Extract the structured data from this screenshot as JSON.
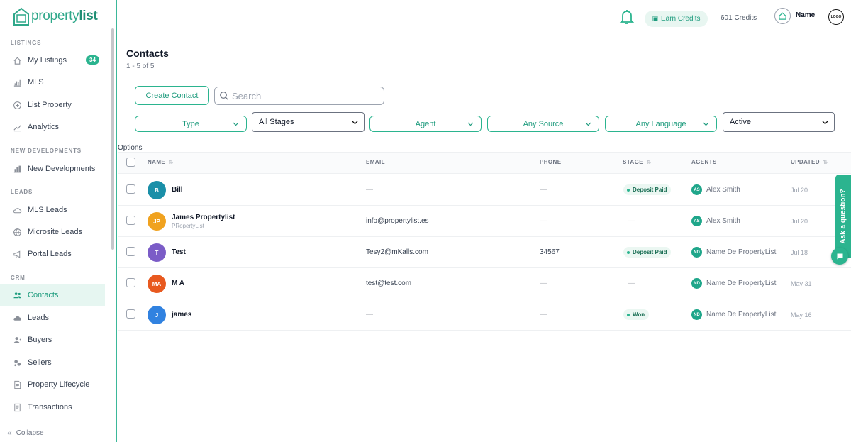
{
  "app": {
    "logo_text_1": "property",
    "logo_text_2": "list"
  },
  "sidebar": {
    "sections": {
      "listings": "LISTINGS",
      "new_developments": "NEW DEVELOPMENTS",
      "leads": "LEADS",
      "crm": "CRM"
    },
    "items": [
      {
        "label": "My Listings",
        "badge": "34",
        "icon": "home-icon"
      },
      {
        "label": "MLS",
        "icon": "chart-icon"
      },
      {
        "label": "List Property",
        "icon": "plus-circle-icon"
      },
      {
        "label": "Analytics",
        "icon": "trend-icon"
      },
      {
        "label": "New Developments",
        "icon": "building-icon"
      },
      {
        "label": "MLS Leads",
        "icon": "cloud-icon"
      },
      {
        "label": "Microsite Leads",
        "icon": "globe-icon"
      },
      {
        "label": "Portal Leads",
        "icon": "megaphone-icon"
      },
      {
        "label": "Contacts",
        "icon": "users-icon"
      },
      {
        "label": "Leads",
        "icon": "cloud-icon"
      },
      {
        "label": "Buyers",
        "icon": "user-icon"
      },
      {
        "label": "Sellers",
        "icon": "gear-cluster-icon"
      },
      {
        "label": "Property Lifecycle",
        "icon": "document-icon"
      },
      {
        "label": "Transactions",
        "icon": "receipt-icon"
      }
    ],
    "collapse_label": "Collapse"
  },
  "header": {
    "earn_credits": "Earn Credits",
    "credits": "601 Credits",
    "user_name": "Name",
    "brand_badge": "LOGO"
  },
  "main": {
    "title": "Contacts",
    "count": "1 - 5 of 5",
    "create_button": "Create Contact",
    "search_placeholder": "Search",
    "filters": {
      "type": "Type",
      "stages": "All Stages",
      "agent": "Agent",
      "source": "Any Source",
      "language": "Any Language",
      "status": "Active"
    },
    "options_label": "Options",
    "columns": {
      "name": "NAME",
      "email": "EMAIL",
      "phone": "PHONE",
      "stage": "STAGE",
      "agents": "AGENTS",
      "updated": "UPDATED"
    },
    "rows": [
      {
        "initials": "B",
        "name": "Bill",
        "subtitle": "",
        "email": "—",
        "phone": "—",
        "stage": "Deposit Paid",
        "agent_initials": "AS",
        "agent": "Alex Smith",
        "updated": "Jul 20",
        "color": "#1a8fa8"
      },
      {
        "initials": "JP",
        "name": "James Propertylist",
        "subtitle": "PRopertyList",
        "email": "info@propertylist.es",
        "phone": "—",
        "stage": "—",
        "agent_initials": "AS",
        "agent": "Alex Smith",
        "updated": "Jul 20",
        "color": "#f0a21f"
      },
      {
        "initials": "T",
        "name": "Test",
        "subtitle": "",
        "email": "Tesy2@mKalls.com",
        "phone": "34567",
        "stage": "Deposit Paid",
        "agent_initials": "ND",
        "agent": "Name De PropertyList",
        "updated": "Jul 18",
        "color": "#7b5cc7"
      },
      {
        "initials": "MA",
        "name": "M A",
        "subtitle": "",
        "email": "test@test.com",
        "phone": "—",
        "stage": "—",
        "agent_initials": "ND",
        "agent": "Name De PropertyList",
        "updated": "May 31",
        "color": "#e8591f"
      },
      {
        "initials": "J",
        "name": "james",
        "subtitle": "",
        "email": "—",
        "phone": "—",
        "stage": "Won",
        "agent_initials": "ND",
        "agent": "Name De PropertyList",
        "updated": "May 16",
        "color": "#3182e0"
      }
    ]
  },
  "help": {
    "ask_label": "Ask a question?"
  },
  "colors": {
    "accent": "#2bb48f",
    "accent_dark": "#1f9c7e",
    "active_bg": "#e6f6f1"
  }
}
